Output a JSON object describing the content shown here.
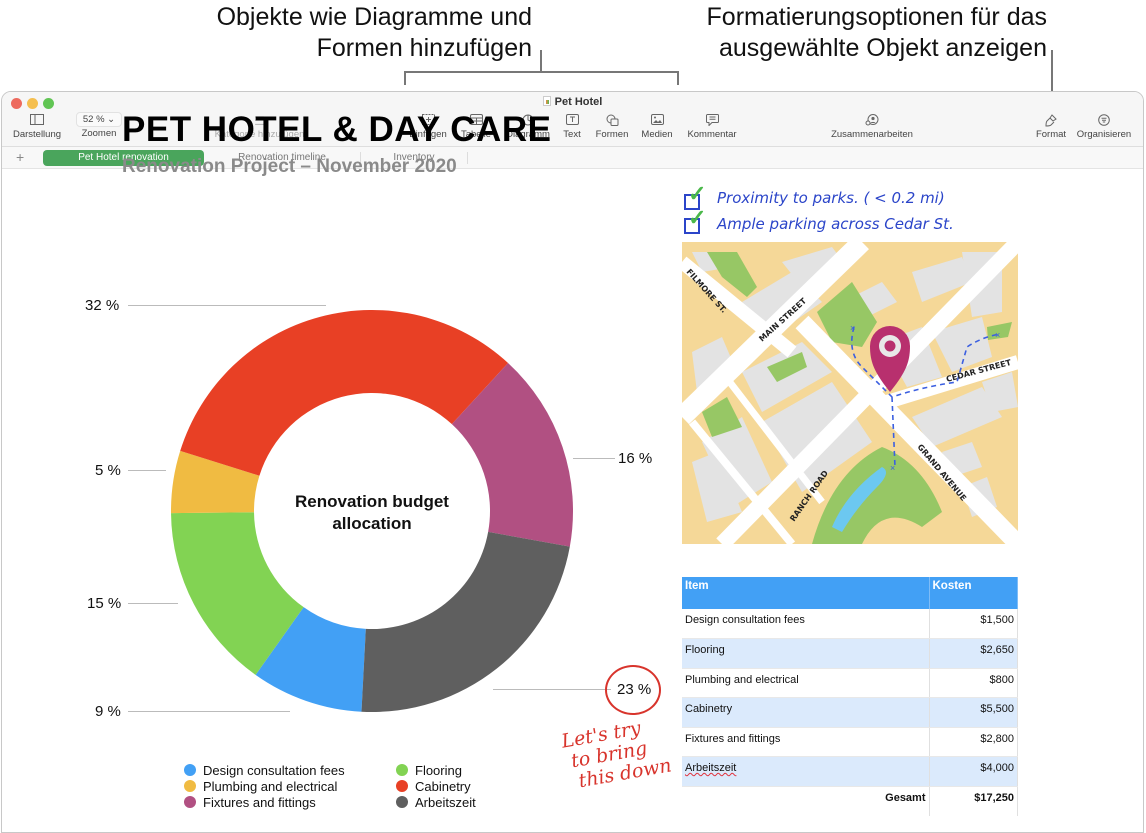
{
  "callouts": {
    "insert_objects": [
      "Objekte wie Diagramme und",
      "Formen hinzufügen"
    ],
    "format_options": [
      "Formatierungsoptionen für das",
      "ausgewählte Objekt anzeigen"
    ]
  },
  "window": {
    "title": "Pet Hotel",
    "traffic_lights": {
      "close": "#ed6a5e",
      "minimize": "#f5bf4f",
      "zoom": "#61c554"
    }
  },
  "toolbar": {
    "view": {
      "label": "Darstellung",
      "icon": "sidebar-icon"
    },
    "zoom": {
      "label": "Zoomen",
      "value": "52 %"
    },
    "add_category": {
      "label": "Kategorie hinzufügen",
      "icon": "list-icon",
      "disabled": true
    },
    "insert": {
      "label": "Einfügen",
      "icon": "insert-icon"
    },
    "table": {
      "label": "Tabelle",
      "icon": "table-icon"
    },
    "chart": {
      "label": "Diagramm",
      "icon": "chart-icon"
    },
    "text": {
      "label": "Text",
      "icon": "text-box-icon"
    },
    "shapes": {
      "label": "Formen",
      "icon": "shapes-icon"
    },
    "media": {
      "label": "Medien",
      "icon": "media-icon"
    },
    "comment": {
      "label": "Kommentar",
      "icon": "comment-icon"
    },
    "collaborate": {
      "label": "Zusammenarbeiten",
      "icon": "collaborate-icon"
    },
    "format": {
      "label": "Format",
      "icon": "paintbrush-icon"
    },
    "organize": {
      "label": "Organisieren",
      "icon": "organize-icon"
    }
  },
  "tabs": {
    "add_label": "+",
    "items": [
      {
        "label": "Pet Hotel renovation",
        "active": true
      },
      {
        "label": "Renovation timeline",
        "active": false
      },
      {
        "label": "Inventory",
        "active": false
      }
    ],
    "active_color": "#4aa55c"
  },
  "document": {
    "title": "PET HOTEL & DAY CARE",
    "subtitle": "Renovation Project – November 2020"
  },
  "chart_data": {
    "type": "pie",
    "variant": "donut",
    "title": "Renovation budget allocation",
    "categories": [
      "Design consultation fees",
      "Flooring",
      "Plumbing and electrical",
      "Cabinetry",
      "Fixtures and fittings",
      "Arbeitszeit"
    ],
    "values": [
      9,
      15,
      5,
      32,
      16,
      23
    ],
    "value_labels": [
      "9 %",
      "15 %",
      "5 %",
      "32 %",
      "16 %",
      "23 %"
    ],
    "colors": [
      "#42a0f5",
      "#82d353",
      "#f0bb42",
      "#e84025",
      "#b15082",
      "#5f5f5f"
    ],
    "legend": {
      "placement": "bottom",
      "entries": [
        {
          "label": "Design consultation fees",
          "color": "#42a0f5"
        },
        {
          "label": "Plumbing and electrical",
          "color": "#f0bb42"
        },
        {
          "label": "Fixtures and fittings",
          "color": "#b15082"
        },
        {
          "label": "Flooring",
          "color": "#82d353"
        },
        {
          "label": "Cabinetry",
          "color": "#e84025"
        },
        {
          "label": "Arbeitszeit",
          "color": "#5f5f5f"
        }
      ]
    }
  },
  "annotations": {
    "checklist": [
      "Proximity to parks. ( < 0.2 mi)",
      "Ample parking across  Cedar St."
    ],
    "note_lines": [
      "Let's try",
      "to bring",
      "this down"
    ]
  },
  "map": {
    "streets": [
      "FILMORE ST.",
      "MAIN STREET",
      "CEDAR STREET",
      "GRAND AVENUE",
      "RANCH ROAD"
    ]
  },
  "cost_table": {
    "headers": [
      "Item",
      "Kosten"
    ],
    "rows": [
      {
        "item": "Design consultation fees",
        "cost": "$1,500"
      },
      {
        "item": "Flooring",
        "cost": "$2,650"
      },
      {
        "item": "Plumbing and electrical",
        "cost": "$800"
      },
      {
        "item": "Cabinetry",
        "cost": "$5,500"
      },
      {
        "item": "Fixtures and fittings",
        "cost": "$2,800"
      },
      {
        "item": "Arbeitszeit",
        "cost": "$4,000"
      }
    ],
    "total": {
      "label": "Gesamt",
      "value": "$17,250"
    },
    "header_color": "#42a0f5",
    "alt_row_color": "#dbeafc"
  }
}
